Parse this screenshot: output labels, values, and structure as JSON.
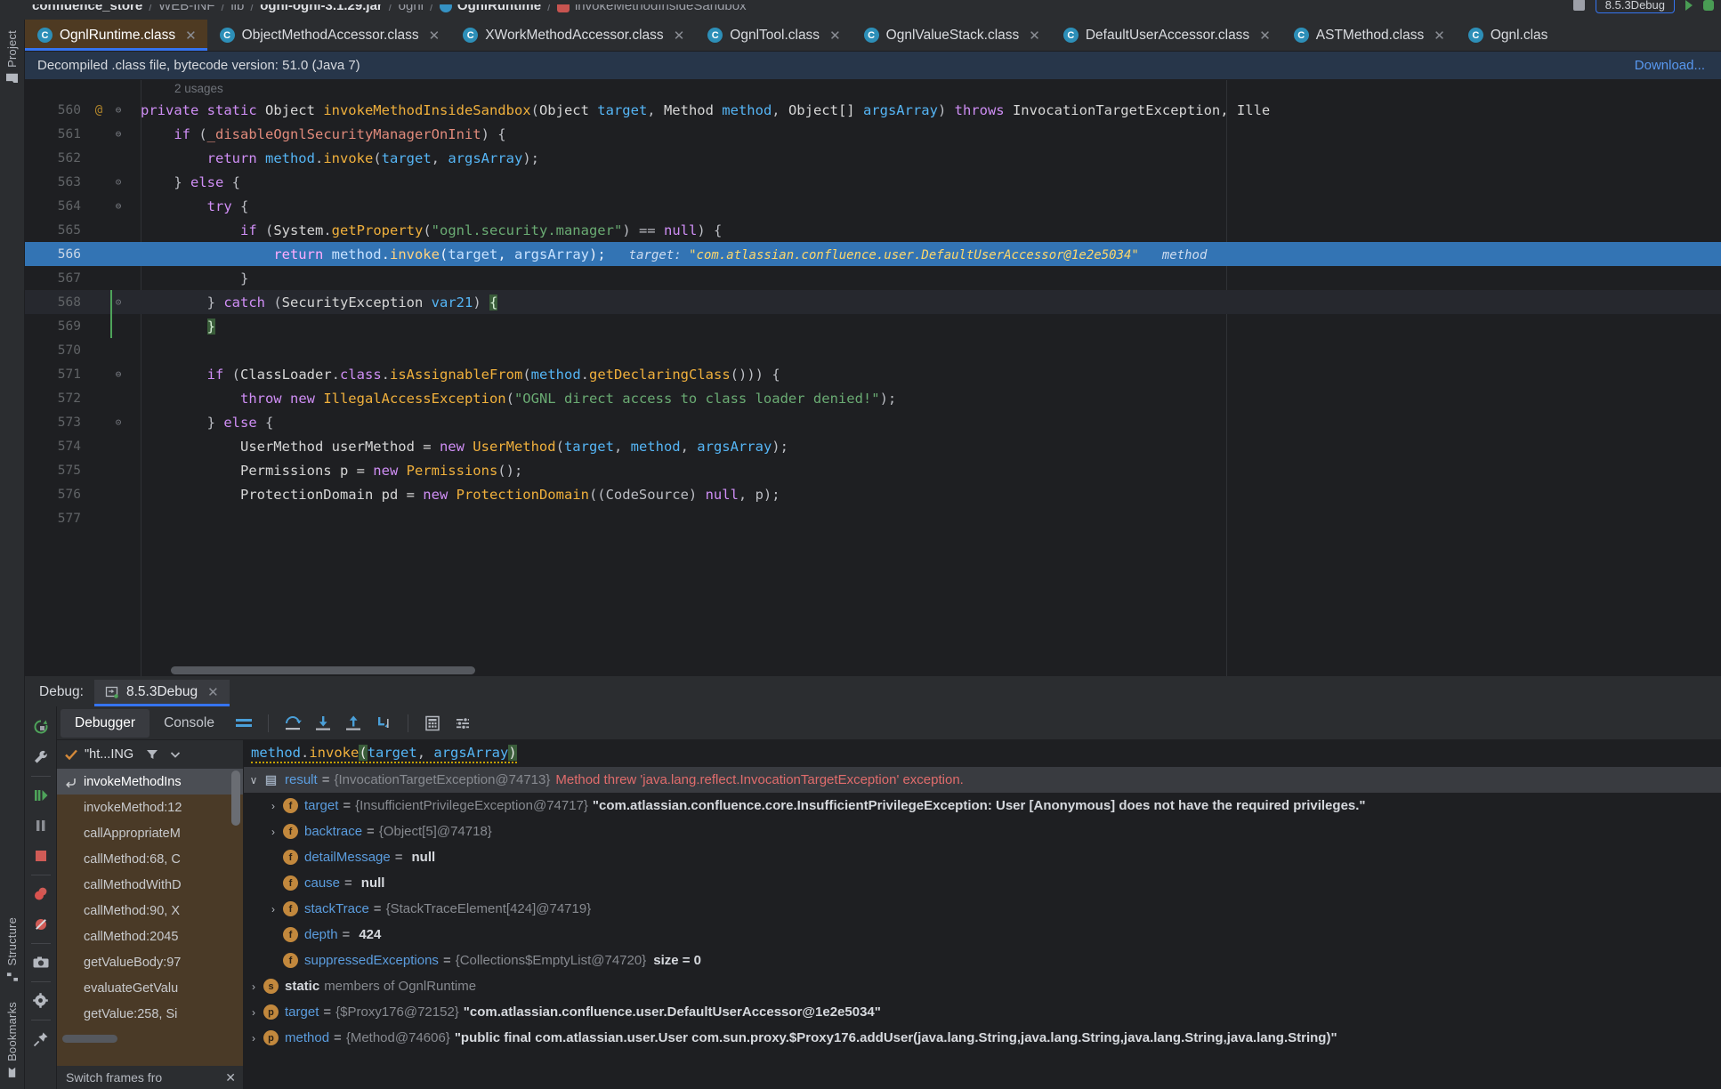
{
  "breadcrumb": {
    "segments": [
      {
        "label": "confluence_store",
        "icon": "",
        "bold": true
      },
      {
        "label": "WEB-INF",
        "icon": "",
        "bold": false
      },
      {
        "label": "lib",
        "icon": "",
        "bold": false
      },
      {
        "label": "ognl-ognl-3.1.29.jar",
        "icon": "",
        "bold": true
      },
      {
        "label": "ognl",
        "icon": "",
        "bold": false
      },
      {
        "label": "OgnlRuntime",
        "icon": "class",
        "bold": true
      },
      {
        "label": "invokeMethodInsideSandbox",
        "icon": "method",
        "bold": false
      }
    ],
    "run_config": "8.5.3Debug"
  },
  "tabs": [
    {
      "label": "OgnlRuntime.class",
      "active": true
    },
    {
      "label": "ObjectMethodAccessor.class",
      "active": false
    },
    {
      "label": "XWorkMethodAccessor.class",
      "active": false
    },
    {
      "label": "OgnlTool.class",
      "active": false
    },
    {
      "label": "OgnlValueStack.class",
      "active": false
    },
    {
      "label": "DefaultUserAccessor.class",
      "active": false
    },
    {
      "label": "ASTMethod.class",
      "active": false
    },
    {
      "label": "Ognl.clas",
      "active": false
    }
  ],
  "banner": {
    "text": "Decompiled .class file, bytecode version: 51.0 (Java 7)",
    "action": "Download..."
  },
  "editor": {
    "usages_hint": "2 usages",
    "inline_hint": {
      "label": "target:",
      "value": "\"com.atlassian.confluence.user.DefaultUserAccessor@1e2e5034\"",
      "trailing": "method"
    },
    "lines": [
      {
        "num": "560",
        "mark": "@",
        "fold": "⊖",
        "highlight": false,
        "current": false,
        "tokens": [
          {
            "t": "private ",
            "c": "kw"
          },
          {
            "t": "static ",
            "c": "kw"
          },
          {
            "t": "Object ",
            "c": "typ"
          },
          {
            "t": "invokeMethodInsideSandbox",
            "c": "mth"
          },
          {
            "t": "(",
            "c": "pun"
          },
          {
            "t": "Object ",
            "c": "typ"
          },
          {
            "t": "target",
            "c": "par"
          },
          {
            "t": ", ",
            "c": "pun"
          },
          {
            "t": "Method ",
            "c": "typ"
          },
          {
            "t": "method",
            "c": "par"
          },
          {
            "t": ", ",
            "c": "pun"
          },
          {
            "t": "Object[] ",
            "c": "typ"
          },
          {
            "t": "argsArray",
            "c": "par"
          },
          {
            "t": ") ",
            "c": "pun"
          },
          {
            "t": "throws ",
            "c": "kw"
          },
          {
            "t": "InvocationTargetException, Ille",
            "c": "typ"
          }
        ]
      },
      {
        "num": "561",
        "mark": "",
        "fold": "⊖",
        "highlight": false,
        "current": false,
        "tokens": [
          {
            "t": "    ",
            "c": "pun"
          },
          {
            "t": "if ",
            "c": "kw"
          },
          {
            "t": "(",
            "c": "pun"
          },
          {
            "t": "_disableOgnlSecurityManagerOnInit",
            "c": "fld"
          },
          {
            "t": ") {",
            "c": "pun"
          }
        ]
      },
      {
        "num": "562",
        "mark": "",
        "fold": "",
        "highlight": false,
        "current": false,
        "tokens": [
          {
            "t": "        ",
            "c": "pun"
          },
          {
            "t": "return ",
            "c": "kw"
          },
          {
            "t": "method",
            "c": "par"
          },
          {
            "t": ".",
            "c": "pun"
          },
          {
            "t": "invoke",
            "c": "mth"
          },
          {
            "t": "(",
            "c": "pun"
          },
          {
            "t": "target",
            "c": "par"
          },
          {
            "t": ", ",
            "c": "pun"
          },
          {
            "t": "argsArray",
            "c": "par"
          },
          {
            "t": ");",
            "c": "pun"
          }
        ]
      },
      {
        "num": "563",
        "mark": "",
        "fold": "⊝",
        "highlight": false,
        "current": false,
        "tokens": [
          {
            "t": "    } ",
            "c": "pun"
          },
          {
            "t": "else ",
            "c": "kw"
          },
          {
            "t": "{",
            "c": "pun"
          }
        ]
      },
      {
        "num": "564",
        "mark": "",
        "fold": "⊖",
        "highlight": false,
        "current": false,
        "tokens": [
          {
            "t": "        ",
            "c": "pun"
          },
          {
            "t": "try ",
            "c": "kw"
          },
          {
            "t": "{",
            "c": "pun"
          }
        ]
      },
      {
        "num": "565",
        "mark": "",
        "fold": "",
        "highlight": false,
        "current": false,
        "tokens": [
          {
            "t": "            ",
            "c": "pun"
          },
          {
            "t": "if ",
            "c": "kw"
          },
          {
            "t": "(",
            "c": "pun"
          },
          {
            "t": "System",
            "c": "typ"
          },
          {
            "t": ".",
            "c": "pun"
          },
          {
            "t": "getProperty",
            "c": "mth"
          },
          {
            "t": "(",
            "c": "pun"
          },
          {
            "t": "\"ognl.security.manager\"",
            "c": "str"
          },
          {
            "t": ") == ",
            "c": "pun"
          },
          {
            "t": "null",
            "c": "nul"
          },
          {
            "t": ") {",
            "c": "pun"
          }
        ]
      },
      {
        "num": "566",
        "mark": "",
        "fold": "",
        "highlight": true,
        "current": false,
        "tokens": [
          {
            "t": "                ",
            "c": "pun"
          },
          {
            "t": "return ",
            "c": "kw"
          },
          {
            "t": "method",
            "c": "par"
          },
          {
            "t": ".",
            "c": "pun"
          },
          {
            "t": "invoke",
            "c": "mth"
          },
          {
            "t": "(",
            "c": "pun"
          },
          {
            "t": "target",
            "c": "par"
          },
          {
            "t": ", ",
            "c": "pun"
          },
          {
            "t": "argsArray",
            "c": "par"
          },
          {
            "t": ");",
            "c": "pun"
          }
        ]
      },
      {
        "num": "567",
        "mark": "",
        "fold": "",
        "highlight": false,
        "current": false,
        "tokens": [
          {
            "t": "            }",
            "c": "pun"
          }
        ]
      },
      {
        "num": "568",
        "mark": "",
        "fold": "⊝",
        "highlight": false,
        "current": true,
        "tokens": [
          {
            "t": "        } ",
            "c": "pun"
          },
          {
            "t": "catch ",
            "c": "kw"
          },
          {
            "t": "(",
            "c": "pun"
          },
          {
            "t": "SecurityException ",
            "c": "typ"
          },
          {
            "t": "var21",
            "c": "par"
          },
          {
            "t": ") ",
            "c": "pun"
          },
          {
            "t": "{",
            "c": "brace-hl"
          }
        ]
      },
      {
        "num": "569",
        "mark": "",
        "fold": "",
        "highlight": false,
        "current": false,
        "tokens": [
          {
            "t": "        ",
            "c": "pun"
          },
          {
            "t": "}",
            "c": "brace-hl"
          }
        ]
      },
      {
        "num": "570",
        "mark": "",
        "fold": "",
        "highlight": false,
        "current": false,
        "tokens": []
      },
      {
        "num": "571",
        "mark": "",
        "fold": "⊖",
        "highlight": false,
        "current": false,
        "tokens": [
          {
            "t": "        ",
            "c": "pun"
          },
          {
            "t": "if ",
            "c": "kw"
          },
          {
            "t": "(",
            "c": "pun"
          },
          {
            "t": "ClassLoader",
            "c": "typ"
          },
          {
            "t": ".",
            "c": "pun"
          },
          {
            "t": "class",
            "c": "kw"
          },
          {
            "t": ".",
            "c": "pun"
          },
          {
            "t": "isAssignableFrom",
            "c": "mth"
          },
          {
            "t": "(",
            "c": "pun"
          },
          {
            "t": "method",
            "c": "par"
          },
          {
            "t": ".",
            "c": "pun"
          },
          {
            "t": "getDeclaringClass",
            "c": "mth"
          },
          {
            "t": "())) {",
            "c": "pun"
          }
        ]
      },
      {
        "num": "572",
        "mark": "",
        "fold": "",
        "highlight": false,
        "current": false,
        "tokens": [
          {
            "t": "            ",
            "c": "pun"
          },
          {
            "t": "throw ",
            "c": "kw"
          },
          {
            "t": "new ",
            "c": "kw"
          },
          {
            "t": "IllegalAccessException",
            "c": "mth"
          },
          {
            "t": "(",
            "c": "pun"
          },
          {
            "t": "\"OGNL direct access to class loader denied!\"",
            "c": "str"
          },
          {
            "t": ");",
            "c": "pun"
          }
        ]
      },
      {
        "num": "573",
        "mark": "",
        "fold": "⊝",
        "highlight": false,
        "current": false,
        "tokens": [
          {
            "t": "        } ",
            "c": "pun"
          },
          {
            "t": "else ",
            "c": "kw"
          },
          {
            "t": "{",
            "c": "pun"
          }
        ]
      },
      {
        "num": "574",
        "mark": "",
        "fold": "",
        "highlight": false,
        "current": false,
        "tokens": [
          {
            "t": "            ",
            "c": "pun"
          },
          {
            "t": "UserMethod userMethod = ",
            "c": "typ"
          },
          {
            "t": "new ",
            "c": "kw"
          },
          {
            "t": "UserMethod",
            "c": "mth"
          },
          {
            "t": "(",
            "c": "pun"
          },
          {
            "t": "target",
            "c": "par"
          },
          {
            "t": ", ",
            "c": "pun"
          },
          {
            "t": "method",
            "c": "par"
          },
          {
            "t": ", ",
            "c": "pun"
          },
          {
            "t": "argsArray",
            "c": "par"
          },
          {
            "t": ");",
            "c": "pun"
          }
        ]
      },
      {
        "num": "575",
        "mark": "",
        "fold": "",
        "highlight": false,
        "current": false,
        "tokens": [
          {
            "t": "            ",
            "c": "pun"
          },
          {
            "t": "Permissions p = ",
            "c": "typ"
          },
          {
            "t": "new ",
            "c": "kw"
          },
          {
            "t": "Permissions",
            "c": "mth"
          },
          {
            "t": "();",
            "c": "pun"
          }
        ]
      },
      {
        "num": "576",
        "mark": "",
        "fold": "",
        "highlight": false,
        "current": false,
        "tokens": [
          {
            "t": "            ",
            "c": "pun"
          },
          {
            "t": "ProtectionDomain pd = ",
            "c": "typ"
          },
          {
            "t": "new ",
            "c": "kw"
          },
          {
            "t": "ProtectionDomain",
            "c": "mth"
          },
          {
            "t": "((CodeSource) ",
            "c": "pun"
          },
          {
            "t": "null",
            "c": "nul"
          },
          {
            "t": ", p);",
            "c": "pun"
          }
        ]
      },
      {
        "num": "577",
        "mark": "",
        "fold": "",
        "highlight": false,
        "current": false,
        "tokens": []
      }
    ]
  },
  "debug": {
    "title_label": "Debug:",
    "session_name": "8.5.3Debug",
    "tabs": [
      {
        "label": "Debugger",
        "active": true
      },
      {
        "label": "Console",
        "active": false
      }
    ],
    "toolbar_icons": [
      "layout-icon",
      "step-over-icon",
      "step-into-icon",
      "step-out-icon",
      "run-to-cursor-icon",
      "evaluate-icon",
      "settings-list-icon"
    ],
    "left_tools": [
      "rerun-icon",
      "wrench-icon",
      "resume-icon",
      "pause-icon",
      "stop-icon",
      "view-breakpoints-icon",
      "mute-breakpoints-icon",
      "camera-icon",
      "settings-gear-icon",
      "pin-icon"
    ],
    "thread": {
      "label": "\"ht...ING",
      "filter_icon": "filter-icon",
      "dropdown_icon": "chevron-down-icon"
    },
    "frames": [
      {
        "label": "invokeMethodIns",
        "selected": true,
        "has_return_icon": true
      },
      {
        "label": "invokeMethod:12",
        "selected": false,
        "has_return_icon": false
      },
      {
        "label": "callAppropriateM",
        "selected": false,
        "has_return_icon": false
      },
      {
        "label": "callMethod:68, C",
        "selected": false,
        "has_return_icon": false
      },
      {
        "label": "callMethodWithD",
        "selected": false,
        "has_return_icon": false
      },
      {
        "label": "callMethod:90, X",
        "selected": false,
        "has_return_icon": false
      },
      {
        "label": "callMethod:2045",
        "selected": false,
        "has_return_icon": false
      },
      {
        "label": "getValueBody:97",
        "selected": false,
        "has_return_icon": false
      },
      {
        "label": "evaluateGetValu",
        "selected": false,
        "has_return_icon": false
      },
      {
        "label": "getValue:258, Si",
        "selected": false,
        "has_return_icon": false
      }
    ],
    "frames_footer": "Switch frames fro",
    "watch_expression": "method.invoke(target, argsArray)",
    "variables": [
      {
        "indent": 0,
        "arrow": "∨",
        "icon": "res",
        "icon_label": "▤",
        "name": "result",
        "type": "{InvocationTargetException@74713}",
        "error": "Method threw 'java.lang.reflect.InvocationTargetException' exception.",
        "value": "",
        "selected": true
      },
      {
        "indent": 1,
        "arrow": "›",
        "icon": "f",
        "icon_label": "f",
        "name": "target",
        "type": "{InsufficientPrivilegeException@74717}",
        "value": "\"com.atlassian.confluence.core.InsufficientPrivilegeException: User [Anonymous] does not have the required privileges.\"",
        "error": "",
        "selected": false
      },
      {
        "indent": 1,
        "arrow": "›",
        "icon": "f",
        "icon_label": "f",
        "name": "backtrace",
        "type": "{Object[5]@74718}",
        "value": "",
        "error": "",
        "selected": false
      },
      {
        "indent": 1,
        "arrow": "",
        "icon": "f",
        "icon_label": "f",
        "name": "detailMessage",
        "type": "",
        "value": "null",
        "error": "",
        "selected": false
      },
      {
        "indent": 1,
        "arrow": "",
        "icon": "f",
        "icon_label": "f",
        "name": "cause",
        "type": "",
        "value": "null",
        "error": "",
        "selected": false
      },
      {
        "indent": 1,
        "arrow": "›",
        "icon": "f",
        "icon_label": "f",
        "name": "stackTrace",
        "type": "{StackTraceElement[424]@74719}",
        "value": "",
        "error": "",
        "selected": false
      },
      {
        "indent": 1,
        "arrow": "",
        "icon": "f",
        "icon_label": "f",
        "name": "depth",
        "type": "",
        "value": "424",
        "error": "",
        "selected": false
      },
      {
        "indent": 1,
        "arrow": "",
        "icon": "f",
        "icon_label": "f",
        "name": "suppressedExceptions",
        "type": "{Collections$EmptyList@74720}",
        "value": "",
        "size": "size = 0",
        "error": "",
        "selected": false
      },
      {
        "indent": 0,
        "arrow": "›",
        "icon": "s",
        "icon_label": "s",
        "name": "",
        "static_label": "static",
        "static_dim": "members of OgnlRuntime",
        "type": "",
        "value": "",
        "error": "",
        "selected": false
      },
      {
        "indent": 0,
        "arrow": "›",
        "icon": "p",
        "icon_label": "p",
        "name": "target",
        "type": "{$Proxy176@72152}",
        "value": "\"com.atlassian.confluence.user.DefaultUserAccessor@1e2e5034\"",
        "error": "",
        "selected": false
      },
      {
        "indent": 0,
        "arrow": "›",
        "icon": "p",
        "icon_label": "p",
        "name": "method",
        "type": "{Method@74606}",
        "value": "\"public final com.atlassian.user.User com.sun.proxy.$Proxy176.addUser(java.lang.String,java.lang.String,java.lang.String,java.lang.String)\"",
        "error": "",
        "selected": false
      }
    ]
  },
  "left_rail": {
    "top_label": "Project",
    "bottom_labels": [
      "Structure",
      "Bookmarks"
    ]
  },
  "colors": {
    "accent_blue": "#3574f0",
    "highlight_line": "#3374b4",
    "active_tab_bg": "#4e3a22",
    "frames_bg": "#4a3a27",
    "error_red": "#e06c6c",
    "string_green": "#6aab73",
    "method_orange": "#f0b03c"
  }
}
